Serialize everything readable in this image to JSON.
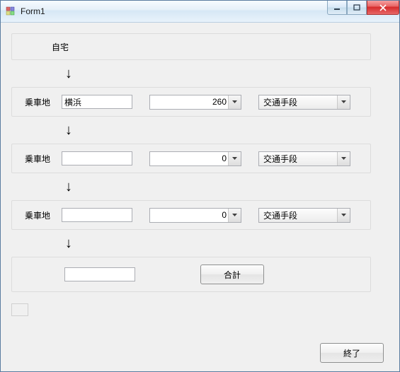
{
  "window": {
    "title": "Form1"
  },
  "home": {
    "label": "自宅"
  },
  "arrows": {
    "glyph": "↓"
  },
  "rows": [
    {
      "label": "乗車地",
      "station": "横浜",
      "fare": "260",
      "transport": "交通手段"
    },
    {
      "label": "乗車地",
      "station": "",
      "fare": "0",
      "transport": "交通手段"
    },
    {
      "label": "乗車地",
      "station": "",
      "fare": "0",
      "transport": "交通手段"
    }
  ],
  "total": {
    "value": "",
    "button": "合計"
  },
  "exit": {
    "label": "終了"
  }
}
